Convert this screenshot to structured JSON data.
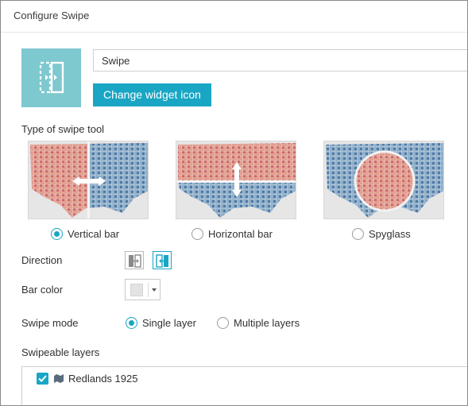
{
  "dialog": {
    "title": "Configure Swipe"
  },
  "widget": {
    "name_value": "Swipe",
    "change_icon_label": "Change widget icon",
    "icon": "swipe-widget-icon"
  },
  "swipe_type": {
    "label": "Type of swipe tool",
    "options": [
      {
        "label": "Vertical bar",
        "selected": true
      },
      {
        "label": "Horizontal bar",
        "selected": false
      },
      {
        "label": "Spyglass",
        "selected": false
      }
    ]
  },
  "direction": {
    "label": "Direction",
    "options": [
      {
        "icon": "swipe-left-to-right-icon",
        "selected": false
      },
      {
        "icon": "swipe-right-to-left-icon",
        "selected": true
      }
    ]
  },
  "bar_color": {
    "label": "Bar color",
    "value": "#e3e3e3"
  },
  "swipe_mode": {
    "label": "Swipe mode",
    "options": [
      {
        "label": "Single layer",
        "selected": true
      },
      {
        "label": "Multiple layers",
        "selected": false
      }
    ]
  },
  "swipeable_layers": {
    "label": "Swipeable layers",
    "items": [
      {
        "label": "Redlands 1925",
        "checked": true
      }
    ]
  },
  "colors": {
    "accent": "#19a6c4",
    "icon_bg": "#7ec8cf",
    "red_map": "#d98a80",
    "blue_map": "#7e9fc0"
  }
}
